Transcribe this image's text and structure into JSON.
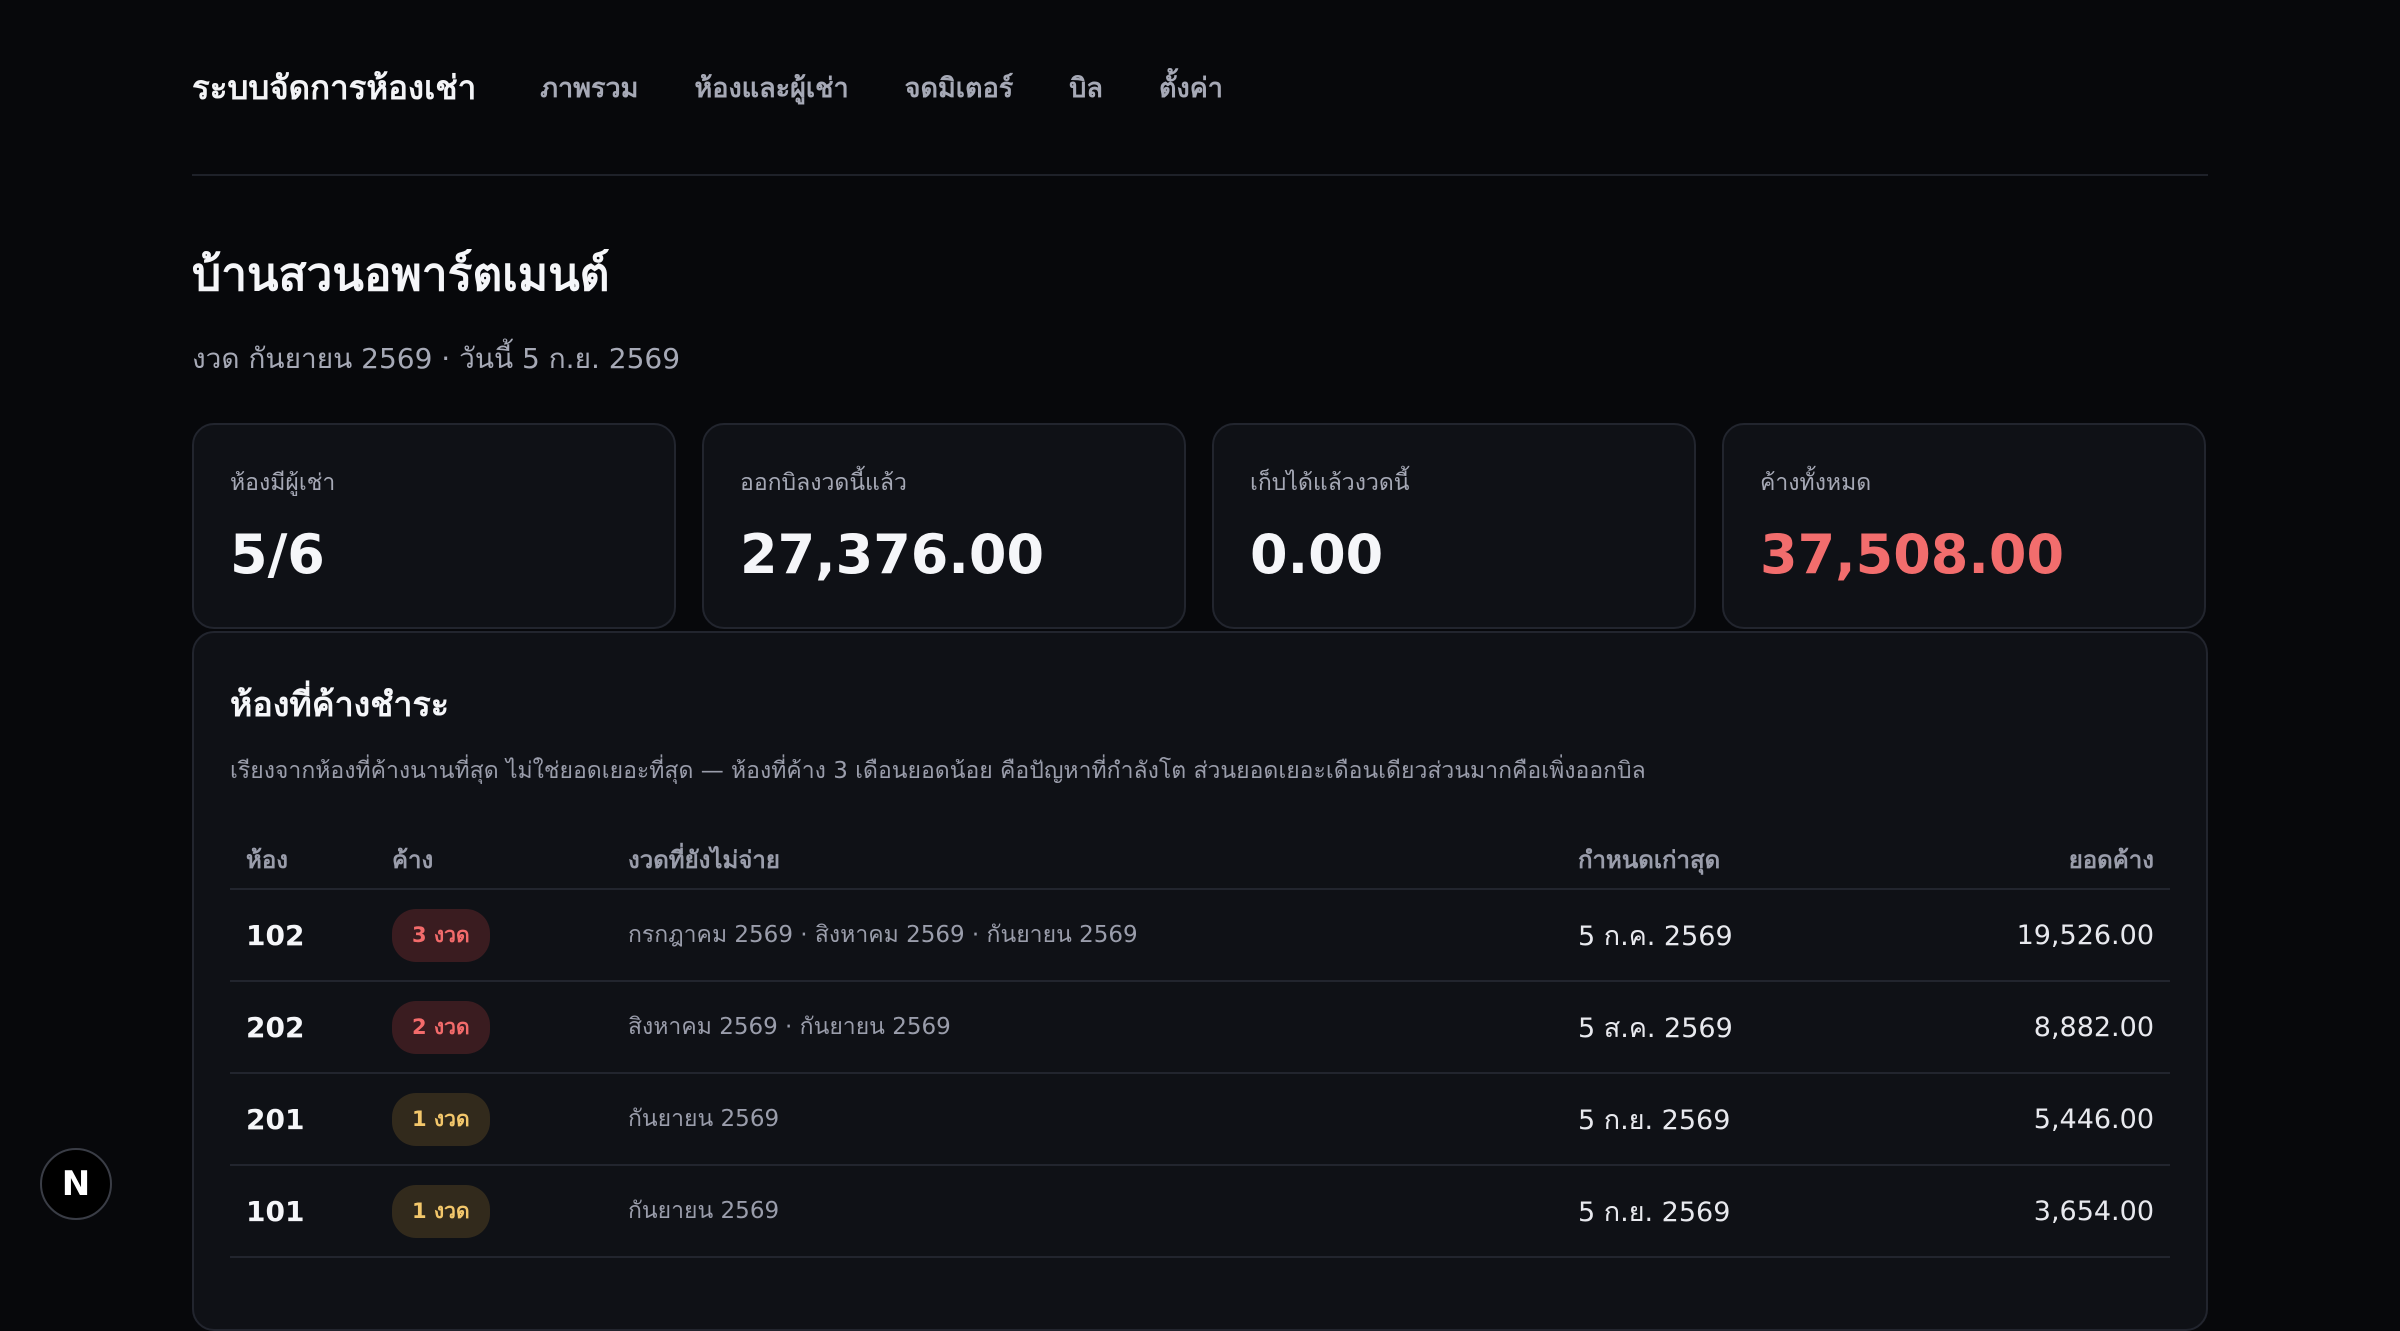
{
  "nav": {
    "brand": "ระบบจัดการห้องเช่า",
    "items": [
      "ภาพรวม",
      "ห้องและผู้เช่า",
      "จดมิเตอร์",
      "บิล",
      "ตั้งค่า"
    ]
  },
  "header": {
    "title": "บ้านสวนอพาร์ตเมนต์",
    "subtitle": "งวด กันยายน 2569 · วันนี้ 5 ก.ย. 2569"
  },
  "cards": [
    {
      "label": "ห้องมีผู้เช่า",
      "value": "5/6"
    },
    {
      "label": "ออกบิลงวดนี้แล้ว",
      "value": "27,376.00"
    },
    {
      "label": "เก็บได้แล้วงวดนี้",
      "value": "0.00"
    },
    {
      "label": "ค้างทั้งหมด",
      "value": "37,508.00"
    }
  ],
  "overdue": {
    "title": "ห้องที่ค้างชำระ",
    "description": "เรียงจากห้องที่ค้างนานที่สุด ไม่ใช่ยอดเยอะที่สุด — ห้องที่ค้าง 3 เดือนยอดน้อย คือปัญหาที่กำลังโต ส่วนยอดเยอะเดือนเดียวส่วนมากคือเพิ่งออกบิล",
    "columns": [
      "ห้อง",
      "ค้าง",
      "งวดที่ยังไม่จ่าย",
      "กำหนดเก่าสุด",
      "ยอดค้าง"
    ],
    "rows": [
      {
        "room": "102",
        "badge": "3 งวด",
        "months": "กรกฎาคม 2569 · สิงหาคม 2569 · กันยายน 2569",
        "due": "5 ก.ค. 2569",
        "amount": "19,526.00"
      },
      {
        "room": "202",
        "badge": "2 งวด",
        "months": "สิงหาคม 2569 · กันยายน 2569",
        "due": "5 ส.ค. 2569",
        "amount": "8,882.00"
      },
      {
        "room": "201",
        "badge": "1 งวด",
        "months": "กันยายน 2569",
        "due": "5 ก.ย. 2569",
        "amount": "5,446.00"
      },
      {
        "room": "101",
        "badge": "1 งวด",
        "months": "กันยายน 2569",
        "due": "5 ก.ย. 2569",
        "amount": "3,654.00"
      }
    ]
  },
  "fab": {
    "label": "N"
  },
  "colors": {
    "alert": "#f26d6d",
    "badge_red": "#f36b6b",
    "badge_yellow": "#f3c76b",
    "background": "#07080b"
  }
}
